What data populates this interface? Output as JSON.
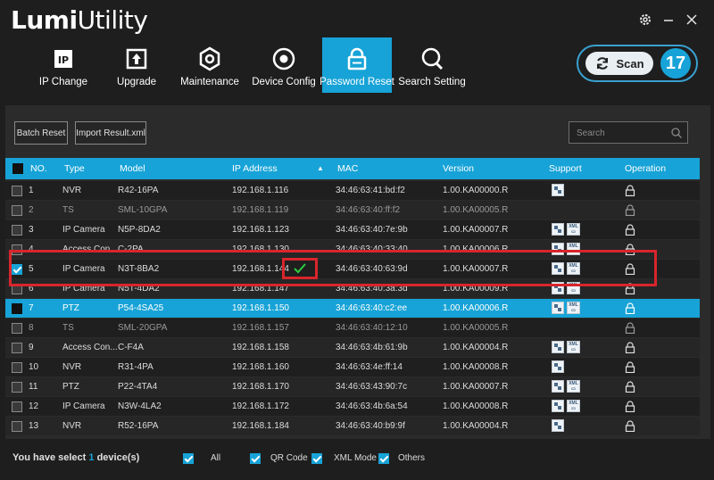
{
  "app": {
    "logo_bold": "Lumi",
    "logo_light": "Utility"
  },
  "nav": [
    {
      "label": "IP Change",
      "icon": "ip-icon"
    },
    {
      "label": "Upgrade",
      "icon": "upgrade-icon"
    },
    {
      "label": "Maintenance",
      "icon": "maintenance-icon"
    },
    {
      "label": "Device Config",
      "icon": "device-config-icon"
    },
    {
      "label": "Password Reset",
      "icon": "password-reset-icon",
      "active": true
    },
    {
      "label": "Search Setting",
      "icon": "search-setting-icon"
    }
  ],
  "scan": {
    "label": "Scan",
    "count": "17"
  },
  "toolbar": {
    "batch_reset": "Batch Reset",
    "import_result": "Import Result.xml",
    "search_placeholder": "Search"
  },
  "table": {
    "headers": {
      "no": "NO.",
      "type": "Type",
      "model": "Model",
      "ip": "IP Address",
      "sort": "▲",
      "mac": "MAC",
      "version": "Version",
      "support": "Support",
      "operation": "Operation"
    },
    "rows": [
      {
        "no": "1",
        "type": "NVR",
        "model": "R42-16PA",
        "ip": "192.168.1.116",
        "mac": "34:46:63:41:bd:f2",
        "version": "1.00.KA00000.R",
        "qr": true,
        "xml": false,
        "checked": false
      },
      {
        "no": "2",
        "type": "TS",
        "model": "SML-10GPA",
        "ip": "192.168.1.119",
        "mac": "34:46:63:40:ff:f2",
        "version": "1.00.KA00005.R",
        "qr": false,
        "xml": false,
        "checked": false,
        "dim": true
      },
      {
        "no": "3",
        "type": "IP Camera",
        "model": "N5P-8DA2",
        "ip": "192.168.1.123",
        "mac": "34:46:63:40:7e:9b",
        "version": "1.00.KA00007.R",
        "qr": true,
        "xml": true,
        "checked": false
      },
      {
        "no": "4",
        "type": "Access Con...",
        "model": "C-2PA",
        "ip": "192.168.1.130",
        "mac": "34:46:63:40:33:40",
        "version": "1.00.KA00006.R",
        "qr": true,
        "xml": true,
        "checked": false
      },
      {
        "no": "5",
        "type": "IP Camera",
        "model": "N3T-8BA2",
        "ip": "192.168.1.144",
        "mac": "34:46:63:40:63:9d",
        "version": "1.00.KA00007.R",
        "qr": true,
        "xml": true,
        "checked": true
      },
      {
        "no": "6",
        "type": "IP Camera",
        "model": "N5T-4DA2",
        "ip": "192.168.1.147",
        "mac": "34:46:63:40:3a:3d",
        "version": "1.00.KA00009.R",
        "qr": true,
        "xml": true,
        "checked": false
      },
      {
        "no": "7",
        "type": "PTZ",
        "model": "P54-4SA25",
        "ip": "192.168.1.150",
        "mac": "34:46:63:40:c2:ee",
        "version": "1.00.KA00006.R",
        "qr": true,
        "xml": true,
        "checked": false,
        "selected": true
      },
      {
        "no": "8",
        "type": "TS",
        "model": "SML-20GPA",
        "ip": "192.168.1.157",
        "mac": "34:46:63:40:12:10",
        "version": "1.00.KA00005.R",
        "qr": false,
        "xml": false,
        "checked": false,
        "dim": true
      },
      {
        "no": "9",
        "type": "Access Con...",
        "model": "C-F4A",
        "ip": "192.168.1.158",
        "mac": "34:46:63:4b:61:9b",
        "version": "1.00.KA00004.R",
        "qr": true,
        "xml": true,
        "checked": false
      },
      {
        "no": "10",
        "type": "NVR",
        "model": "R31-4PA",
        "ip": "192.168.1.160",
        "mac": "34:46:63:4e:ff:14",
        "version": "1.00.KA00008.R",
        "qr": true,
        "xml": false,
        "checked": false
      },
      {
        "no": "11",
        "type": "PTZ",
        "model": "P22-4TA4",
        "ip": "192.168.1.170",
        "mac": "34:46:63:43:90:7c",
        "version": "1.00.KA00007.R",
        "qr": true,
        "xml": true,
        "checked": false
      },
      {
        "no": "12",
        "type": "IP Camera",
        "model": "N3W-4LA2",
        "ip": "192.168.1.172",
        "mac": "34:46:63:4b:6a:54",
        "version": "1.00.KA00008.R",
        "qr": true,
        "xml": true,
        "checked": false
      },
      {
        "no": "13",
        "type": "NVR",
        "model": "R52-16PA",
        "ip": "192.168.1.184",
        "mac": "34:46:63:40:b9:9f",
        "version": "1.00.KA00004.R",
        "qr": true,
        "xml": false,
        "checked": false
      }
    ]
  },
  "footer": {
    "select_prefix": "You have select ",
    "select_count": "1",
    "select_suffix": " device(s)",
    "filters": [
      {
        "label": "All"
      },
      {
        "label": "QR Code"
      },
      {
        "label": "XML Mode"
      },
      {
        "label": "Others"
      }
    ]
  },
  "colors": {
    "accent": "#17a3d7",
    "highlight": "#d9252c",
    "background": "#1e1e1e"
  }
}
